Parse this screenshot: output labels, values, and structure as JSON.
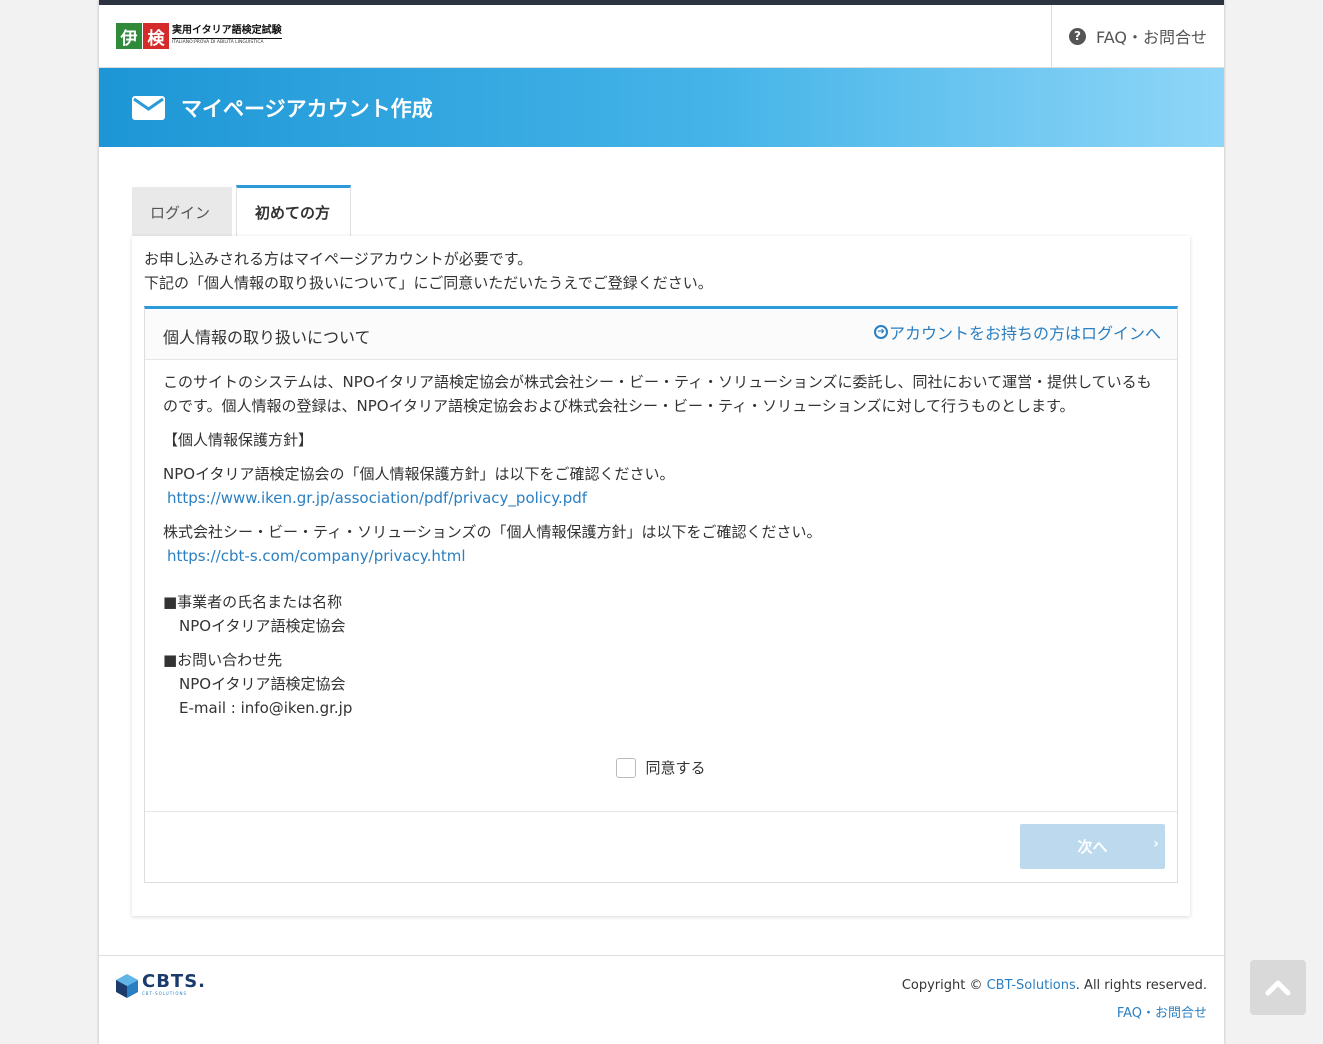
{
  "header": {
    "logo_char1": "伊",
    "logo_char2": "検",
    "logo_jp": "実用イタリア語検定試験",
    "logo_it": "ITALIANO:PROVA DI ABILITÀ LINGUISTICA",
    "faq_label": "FAQ・お問合せ"
  },
  "banner": {
    "icon": "envelope-icon",
    "title": "マイページアカウント作成"
  },
  "tabs": [
    {
      "label": "ログイン",
      "active": false
    },
    {
      "label": "初めての方",
      "active": true
    }
  ],
  "intro": {
    "line1": "お申し込みされる方はマイページアカウントが必要です。",
    "line2": "下記の「個人情報の取り扱いについて」にご同意いただいたうえでご登録ください。"
  },
  "panel": {
    "title": "個人情報の取り扱いについて",
    "login_link": "アカウントをお持ちの方はログインへ",
    "para1": "このサイトのシステムは、NPOイタリア語検定協会が株式会社シー・ビー・ティ・ソリューションズに委託し、同社において運営・提供しているものです。個人情報の登録は、NPOイタリア語検定協会および株式会社シー・ビー・ティ・ソリューションズに対して行うものとします。",
    "policy_heading": "【個人情報保護方針】",
    "policy1_text": "NPOイタリア語検定協会の「個人情報保護方針」は以下をご確認ください。",
    "policy1_url": "https://www.iken.gr.jp/association/pdf/privacy_policy.pdf",
    "policy2_text": "株式会社シー・ビー・ティ・ソリューションズの「個人情報保護方針」は以下をご確認ください。",
    "policy2_url": "https://cbt-s.com/company/privacy.html",
    "operator_heading": "■事業者の氏名または名称",
    "operator_name": "NPOイタリア語検定協会",
    "contact_heading": "■お問い合わせ先",
    "contact_name": "NPOイタリア語検定協会",
    "contact_email": "E-mail : info@iken.gr.jp",
    "agree_label": "同意する",
    "agree_checked": false,
    "next_label": "次へ"
  },
  "footer": {
    "logo_main": "CBTS.",
    "logo_sub": "CBT-SOLUTIONS",
    "copyright_prefix": "Copyright © ",
    "copyright_company": "CBT-Solutions",
    "copyright_suffix": ". All rights reserved.",
    "faq_label": "FAQ・お問合せ"
  },
  "colors": {
    "accent": "#2a9bd8",
    "link": "#2a7fc2",
    "next_disabled": "#bcd9ee"
  }
}
